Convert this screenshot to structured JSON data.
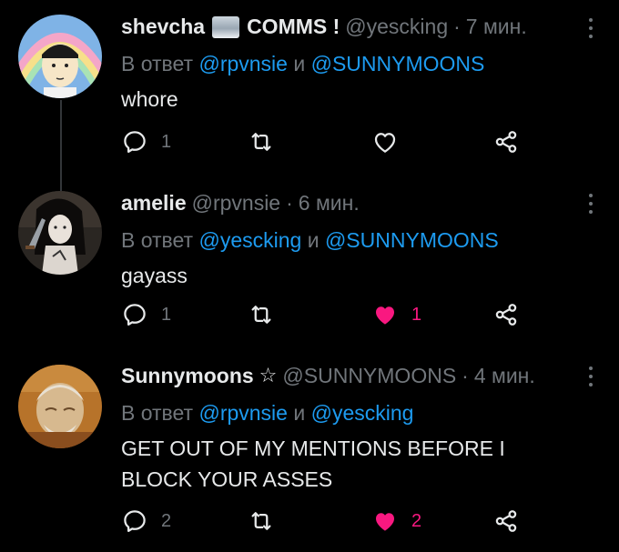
{
  "tweets": [
    {
      "name": "shevcha",
      "name_suffix": "COMMS !",
      "handle": "@yescking",
      "dot": "·",
      "time": "7 мин.",
      "reply_prefix": "В ответ",
      "reply_mention_1": "@rpvnsie",
      "reply_joiner": "и",
      "reply_mention_2": "@SUNNYMOONS",
      "text": "whore",
      "reply_count": "1",
      "retweet_count": "",
      "like_count": "",
      "liked": false
    },
    {
      "name": "amelie",
      "handle": "@rpvnsie",
      "dot": "·",
      "time": "6 мин.",
      "reply_prefix": "В ответ",
      "reply_mention_1": "@yescking",
      "reply_joiner": "и",
      "reply_mention_2": "@SUNNYMOONS",
      "text": "gayass",
      "reply_count": "1",
      "retweet_count": "",
      "like_count": "1",
      "liked": true
    },
    {
      "name": "Sunnymoons",
      "star": "☆",
      "handle": "@SUNNYMOONS",
      "dot": "·",
      "time": "4 мин.",
      "reply_prefix": "В ответ",
      "reply_mention_1": "@rpvnsie",
      "reply_joiner": "и",
      "reply_mention_2": "@yescking",
      "text_line_1": "GET OUT OF MY MENTIONS BEFORE I",
      "text_line_2": "BLOCK YOUR ASSES",
      "reply_count": "2",
      "retweet_count": "",
      "like_count": "2",
      "liked": true
    }
  ],
  "icons": {
    "reply": "reply-icon",
    "retweet": "retweet-icon",
    "like": "heart-icon",
    "share": "share-icon",
    "more": "more-dots-icon"
  },
  "colors": {
    "background": "#000000",
    "text": "#e7e9ea",
    "muted": "#71767b",
    "link": "#1d9bf0",
    "like": "#f91880"
  }
}
